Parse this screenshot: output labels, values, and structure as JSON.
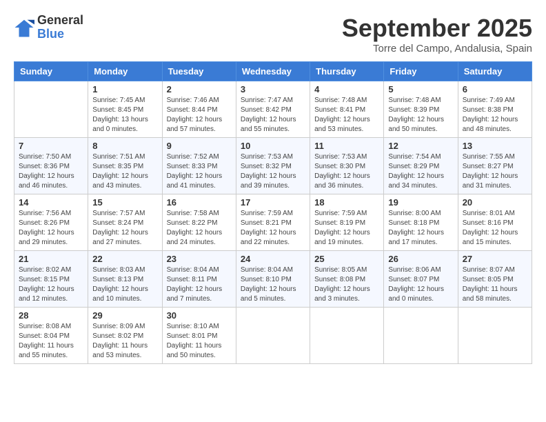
{
  "header": {
    "logo": {
      "general": "General",
      "blue": "Blue"
    },
    "title": "September 2025",
    "location": "Torre del Campo, Andalusia, Spain"
  },
  "calendar": {
    "days_of_week": [
      "Sunday",
      "Monday",
      "Tuesday",
      "Wednesday",
      "Thursday",
      "Friday",
      "Saturday"
    ],
    "weeks": [
      [
        {
          "date": "",
          "info": ""
        },
        {
          "date": "1",
          "info": "Sunrise: 7:45 AM\nSunset: 8:45 PM\nDaylight: 13 hours\nand 0 minutes."
        },
        {
          "date": "2",
          "info": "Sunrise: 7:46 AM\nSunset: 8:44 PM\nDaylight: 12 hours\nand 57 minutes."
        },
        {
          "date": "3",
          "info": "Sunrise: 7:47 AM\nSunset: 8:42 PM\nDaylight: 12 hours\nand 55 minutes."
        },
        {
          "date": "4",
          "info": "Sunrise: 7:48 AM\nSunset: 8:41 PM\nDaylight: 12 hours\nand 53 minutes."
        },
        {
          "date": "5",
          "info": "Sunrise: 7:48 AM\nSunset: 8:39 PM\nDaylight: 12 hours\nand 50 minutes."
        },
        {
          "date": "6",
          "info": "Sunrise: 7:49 AM\nSunset: 8:38 PM\nDaylight: 12 hours\nand 48 minutes."
        }
      ],
      [
        {
          "date": "7",
          "info": "Sunrise: 7:50 AM\nSunset: 8:36 PM\nDaylight: 12 hours\nand 46 minutes."
        },
        {
          "date": "8",
          "info": "Sunrise: 7:51 AM\nSunset: 8:35 PM\nDaylight: 12 hours\nand 43 minutes."
        },
        {
          "date": "9",
          "info": "Sunrise: 7:52 AM\nSunset: 8:33 PM\nDaylight: 12 hours\nand 41 minutes."
        },
        {
          "date": "10",
          "info": "Sunrise: 7:53 AM\nSunset: 8:32 PM\nDaylight: 12 hours\nand 39 minutes."
        },
        {
          "date": "11",
          "info": "Sunrise: 7:53 AM\nSunset: 8:30 PM\nDaylight: 12 hours\nand 36 minutes."
        },
        {
          "date": "12",
          "info": "Sunrise: 7:54 AM\nSunset: 8:29 PM\nDaylight: 12 hours\nand 34 minutes."
        },
        {
          "date": "13",
          "info": "Sunrise: 7:55 AM\nSunset: 8:27 PM\nDaylight: 12 hours\nand 31 minutes."
        }
      ],
      [
        {
          "date": "14",
          "info": "Sunrise: 7:56 AM\nSunset: 8:26 PM\nDaylight: 12 hours\nand 29 minutes."
        },
        {
          "date": "15",
          "info": "Sunrise: 7:57 AM\nSunset: 8:24 PM\nDaylight: 12 hours\nand 27 minutes."
        },
        {
          "date": "16",
          "info": "Sunrise: 7:58 AM\nSunset: 8:22 PM\nDaylight: 12 hours\nand 24 minutes."
        },
        {
          "date": "17",
          "info": "Sunrise: 7:59 AM\nSunset: 8:21 PM\nDaylight: 12 hours\nand 22 minutes."
        },
        {
          "date": "18",
          "info": "Sunrise: 7:59 AM\nSunset: 8:19 PM\nDaylight: 12 hours\nand 19 minutes."
        },
        {
          "date": "19",
          "info": "Sunrise: 8:00 AM\nSunset: 8:18 PM\nDaylight: 12 hours\nand 17 minutes."
        },
        {
          "date": "20",
          "info": "Sunrise: 8:01 AM\nSunset: 8:16 PM\nDaylight: 12 hours\nand 15 minutes."
        }
      ],
      [
        {
          "date": "21",
          "info": "Sunrise: 8:02 AM\nSunset: 8:15 PM\nDaylight: 12 hours\nand 12 minutes."
        },
        {
          "date": "22",
          "info": "Sunrise: 8:03 AM\nSunset: 8:13 PM\nDaylight: 12 hours\nand 10 minutes."
        },
        {
          "date": "23",
          "info": "Sunrise: 8:04 AM\nSunset: 8:11 PM\nDaylight: 12 hours\nand 7 minutes."
        },
        {
          "date": "24",
          "info": "Sunrise: 8:04 AM\nSunset: 8:10 PM\nDaylight: 12 hours\nand 5 minutes."
        },
        {
          "date": "25",
          "info": "Sunrise: 8:05 AM\nSunset: 8:08 PM\nDaylight: 12 hours\nand 3 minutes."
        },
        {
          "date": "26",
          "info": "Sunrise: 8:06 AM\nSunset: 8:07 PM\nDaylight: 12 hours\nand 0 minutes."
        },
        {
          "date": "27",
          "info": "Sunrise: 8:07 AM\nSunset: 8:05 PM\nDaylight: 11 hours\nand 58 minutes."
        }
      ],
      [
        {
          "date": "28",
          "info": "Sunrise: 8:08 AM\nSunset: 8:04 PM\nDaylight: 11 hours\nand 55 minutes."
        },
        {
          "date": "29",
          "info": "Sunrise: 8:09 AM\nSunset: 8:02 PM\nDaylight: 11 hours\nand 53 minutes."
        },
        {
          "date": "30",
          "info": "Sunrise: 8:10 AM\nSunset: 8:01 PM\nDaylight: 11 hours\nand 50 minutes."
        },
        {
          "date": "",
          "info": ""
        },
        {
          "date": "",
          "info": ""
        },
        {
          "date": "",
          "info": ""
        },
        {
          "date": "",
          "info": ""
        }
      ]
    ]
  }
}
